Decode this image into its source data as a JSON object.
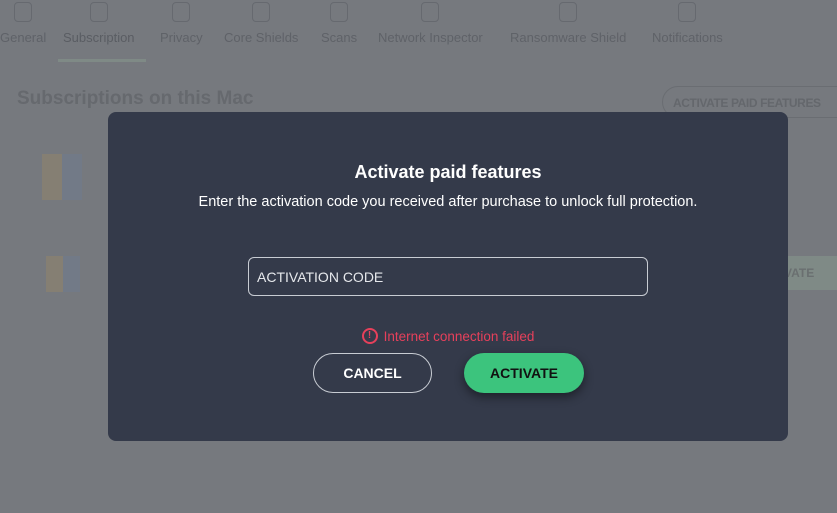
{
  "nav": {
    "items": [
      {
        "label": "General",
        "icon": "document-icon"
      },
      {
        "label": "Subscription",
        "icon": "bookmark-icon",
        "active": true
      },
      {
        "label": "Privacy",
        "icon": "user-icon"
      },
      {
        "label": "Core Shields",
        "icon": "shield-icon"
      },
      {
        "label": "Scans",
        "icon": "magnifier-icon"
      },
      {
        "label": "Network Inspector",
        "icon": "home-shield-icon"
      },
      {
        "label": "Ransomware Shield",
        "icon": "dollar-file-icon"
      },
      {
        "label": "Notifications",
        "icon": "bell-icon"
      }
    ]
  },
  "page": {
    "title": "Subscriptions on this Mac",
    "activate_paid_features": "ACTIVATE PAID FEATURES",
    "row_activate": "ACTIVATE"
  },
  "modal": {
    "title": "Activate paid features",
    "subtitle": "Enter the activation code you received after purchase to unlock full protection.",
    "code_placeholder": "ACTIVATION CODE",
    "error": "Internet connection failed",
    "error_icon": "exclamation-circle-icon",
    "cancel": "CANCEL",
    "activate": "ACTIVATE"
  },
  "colors": {
    "accent": "#3cc47d",
    "error": "#e6405b",
    "modal_bg": "#343a4a"
  }
}
